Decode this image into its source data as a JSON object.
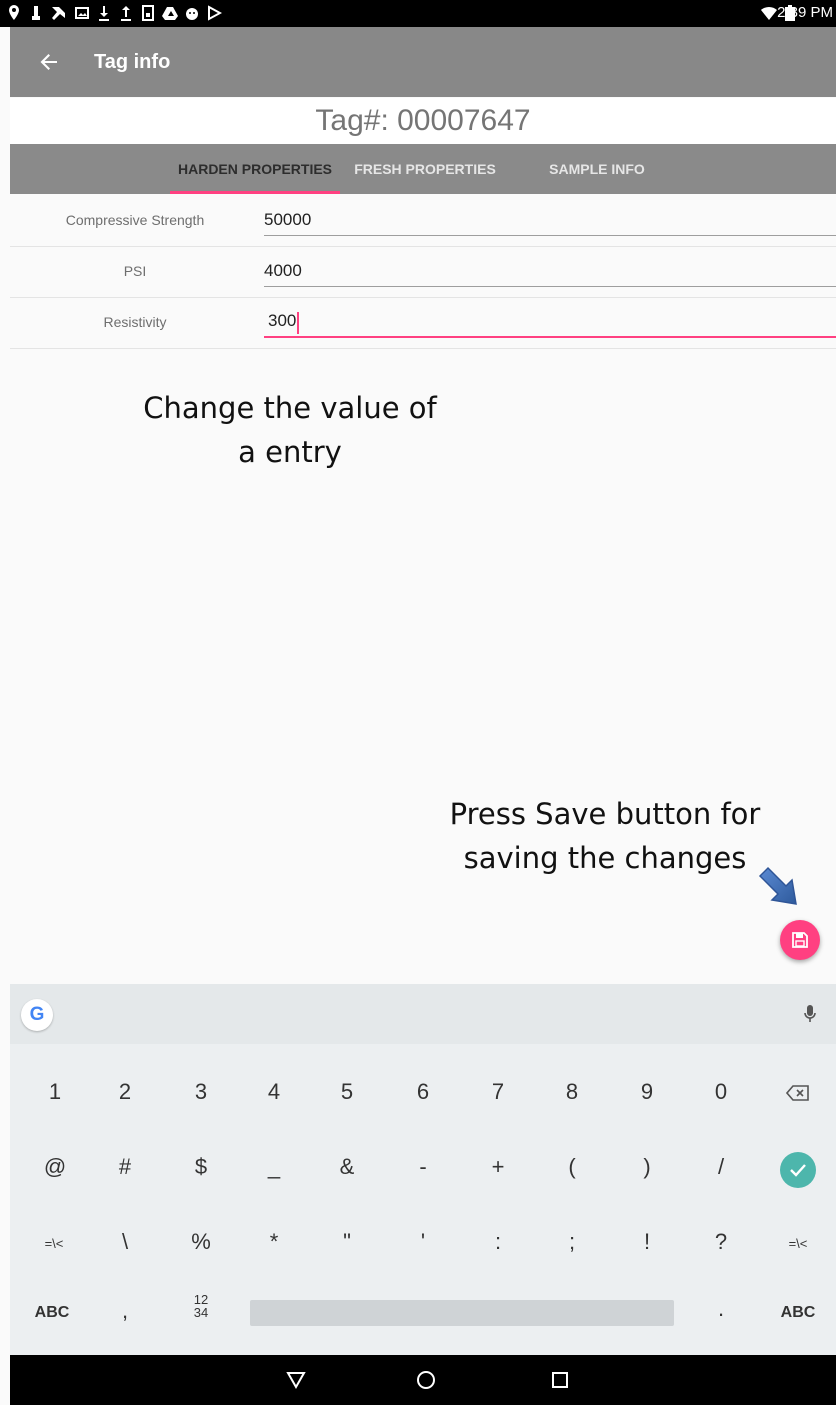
{
  "status_bar": {
    "time": "2:39 PM",
    "left_icons": [
      "location-pin-icon",
      "usb-icon",
      "wrench-icon",
      "image-icon",
      "download-icon",
      "upload-icon",
      "sd-card-icon",
      "drive-icon",
      "android-icon",
      "play-store-icon"
    ],
    "right_icons": [
      "wifi-icon",
      "battery-icon"
    ]
  },
  "app_bar": {
    "title": "Tag info",
    "back_icon": "arrow-left-icon"
  },
  "tag": {
    "label": "Tag#: 00007647"
  },
  "tabs": [
    {
      "label": "HARDEN PROPERTIES",
      "active": true
    },
    {
      "label": "FRESH PROPERTIES",
      "active": false
    },
    {
      "label": "SAMPLE INFO",
      "active": false
    }
  ],
  "form": {
    "rows": [
      {
        "label": "Compressive Strength",
        "value": "50000"
      },
      {
        "label": "PSI",
        "value": "4000"
      },
      {
        "label": "Resistivity",
        "value": "300"
      }
    ]
  },
  "annotations": {
    "change_line1": "Change the value of",
    "change_line2": "a entry",
    "save_line1": "Press Save button for",
    "save_line2": "saving the changes"
  },
  "fab": {
    "icon": "save-icon"
  },
  "keyboard": {
    "google_label": "G",
    "row1": [
      "1",
      "2",
      "3",
      "4",
      "5",
      "6",
      "7",
      "8",
      "9",
      "0"
    ],
    "row2": [
      "@",
      "#",
      "$",
      "_",
      "&",
      "-",
      "+",
      "(",
      ")",
      "/"
    ],
    "row3": [
      "=\\<",
      "\\",
      "%",
      "*",
      "\"",
      "'",
      ":",
      ";",
      "!",
      "?",
      "=\\<"
    ],
    "row4": {
      "abc_left": "ABC",
      "comma": ",",
      "numpad": "12\n34",
      "period": ".",
      "abc_right": "ABC"
    }
  },
  "colors": {
    "accent": "#ff4081",
    "app_bar": "#888888",
    "enter_key": "#4db6ac"
  }
}
